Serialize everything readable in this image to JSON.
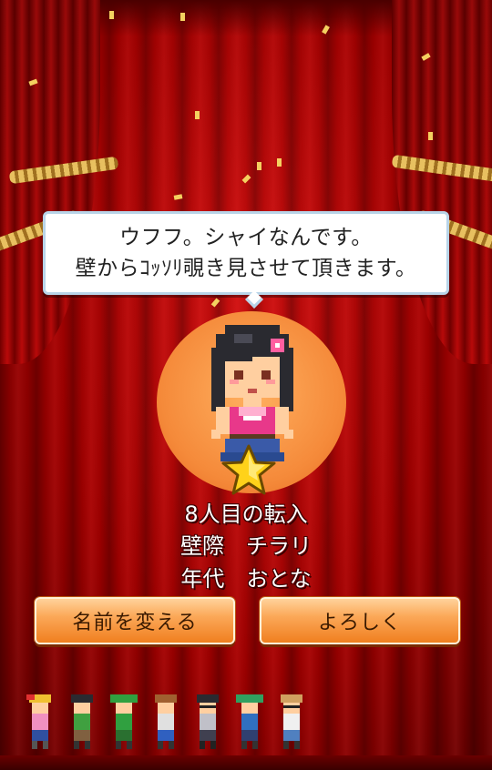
{
  "dialog": {
    "line1": "ウフフ。シャイなんです。",
    "line2": "壁からｺｯｿﾘ覗き見させて頂きます。"
  },
  "character": {
    "arrival_text": "8人目の転入",
    "name_text": "壁際　チラリ",
    "age_text": "年代　おとな"
  },
  "buttons": {
    "rename_label": "名前を変える",
    "ok_label": "よろしく"
  },
  "roster": {
    "count": 7
  },
  "colors": {
    "curtain": "#b00000",
    "spotlight": "#f58a3a",
    "button": "#f79a45",
    "star": "#ffd21a"
  },
  "icons": [
    "star-icon",
    "character-sprite",
    "roster-avatar"
  ]
}
